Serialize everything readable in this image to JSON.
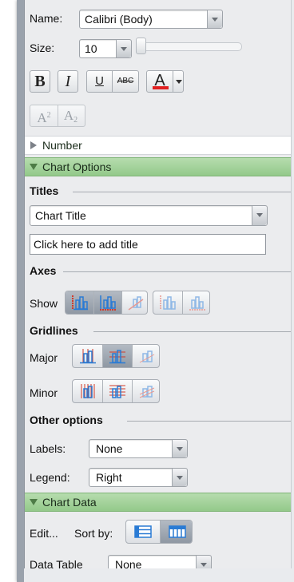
{
  "font": {
    "name_label": "Name:",
    "name_value": "Calibri (Body)",
    "size_label": "Size:",
    "size_value": "10",
    "bold_label": "B",
    "italic_label": "I",
    "underline_label": "U",
    "strike_label": "ABC",
    "color_label": "A",
    "color_swatch": "#e02020",
    "superscript_label": "A",
    "superscript_mark": "2",
    "subscript_label": "A",
    "subscript_mark": "2"
  },
  "sections": {
    "number": "Number",
    "chart_options": "Chart Options",
    "chart_data": "Chart Data"
  },
  "titles": {
    "header": "Titles",
    "selected": "Chart Title",
    "input_placeholder": "Click here to add title"
  },
  "axes": {
    "header": "Axes",
    "show_label": "Show",
    "buttons": [
      "vertical-axis-icon",
      "horizontal-axis-icon",
      "depth-axis-icon",
      "secondary-vertical-axis-icon",
      "secondary-horizontal-axis-icon"
    ],
    "active": [
      true,
      true,
      false,
      false,
      false
    ]
  },
  "gridlines": {
    "header": "Gridlines",
    "major_label": "Major",
    "minor_label": "Minor",
    "major_active": [
      false,
      true,
      false
    ],
    "minor_active": [
      false,
      false,
      false
    ]
  },
  "other": {
    "header": "Other options",
    "labels_label": "Labels:",
    "labels_value": "None",
    "legend_label": "Legend:",
    "legend_value": "Right"
  },
  "data": {
    "edit_label": "Edit...",
    "sort_label": "Sort by:",
    "sort_rows_active": false,
    "sort_columns_active": true,
    "table_label": "Data Table",
    "table_value": "None"
  },
  "colors": {
    "section_green": "#a6d39c",
    "active_button": "#9aa3ad",
    "chart_icon_blue": "#2a7bd4",
    "chart_icon_red": "#d23a2a"
  }
}
